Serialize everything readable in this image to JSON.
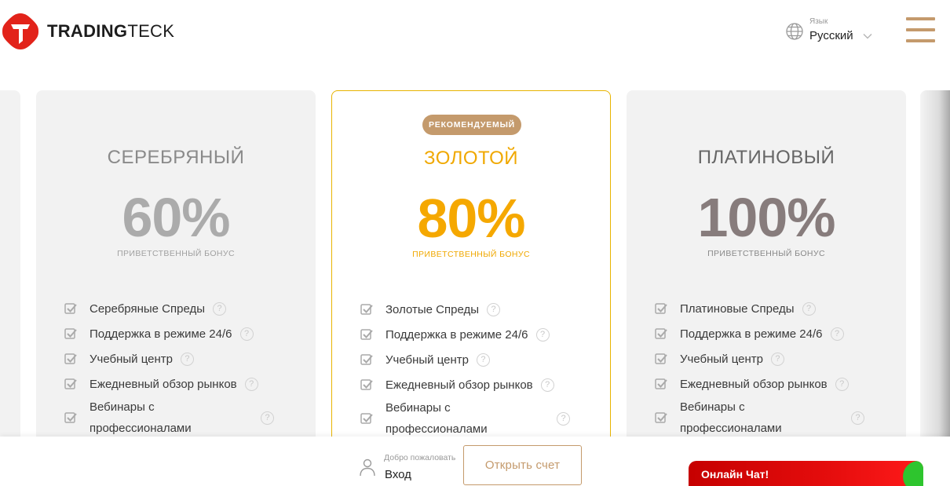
{
  "header": {
    "logo_bold": "TRADING",
    "logo_light": "TECK",
    "language_caption": "Язык",
    "language_value": "Русский"
  },
  "colors": {
    "accent": "#c49a6c",
    "gold": "#f5a800",
    "chat_red": "#e50d0d",
    "chat_green": "#2ec52e"
  },
  "plans": [
    {
      "name": "СЕРЕБРЯНЫЙ",
      "bonus": "60%",
      "bonus_caption": "ПРИВЕТСТВЕННЫЙ БОНУС",
      "features": [
        "Серебряные Спреды",
        "Поддержка в режиме 24/6",
        "Учебный центр",
        "Ежедневный обзор рынков",
        "Вебинары с профессионалами"
      ]
    },
    {
      "badge": "РЕКОМЕНДУЕМЫЙ",
      "name": "ЗОЛОТОЙ",
      "bonus": "80%",
      "bonus_caption": "ПРИВЕТСТВЕННЫЙ БОНУС",
      "features": [
        "Золотые Спреды",
        "Поддержка в режиме 24/6",
        "Учебный центр",
        "Ежедневный обзор рынков",
        "Вебинары с профессионалами"
      ]
    },
    {
      "name": "ПЛАТИНОВЫЙ",
      "bonus": "100%",
      "bonus_caption": "ПРИВЕТСТВЕННЫЙ БОНУС",
      "features": [
        "Платиновые Спреды",
        "Поддержка в режиме 24/6",
        "Учебный центр",
        "Ежедневный обзор рынков",
        "Вебинары с профессионалами"
      ]
    }
  ],
  "help_glyph": "?",
  "bottom": {
    "welcome": "Добро пожаловать",
    "login": "Вход",
    "open_account": "Открыть счет",
    "chat": "Онлайн Чат!"
  }
}
